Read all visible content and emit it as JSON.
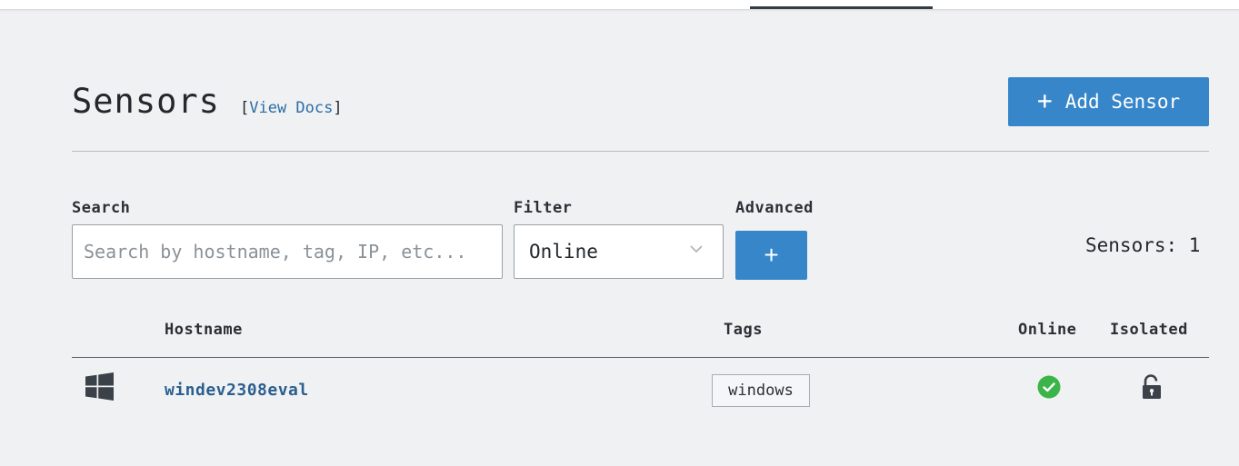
{
  "header": {
    "title": "Sensors",
    "docs_open": "[",
    "docs_link": "View Docs",
    "docs_close": "]",
    "add_button_label": "Add Sensor",
    "add_button_icon": "plus-icon"
  },
  "controls": {
    "search_label": "Search",
    "search_placeholder": "Search by hostname, tag, IP, etc...",
    "search_value": "",
    "filter_label": "Filter",
    "filter_value": "Online",
    "advanced_label": "Advanced",
    "advanced_button": "+",
    "sensor_count": "Sensors: 1"
  },
  "table": {
    "columns": [
      "",
      "Hostname",
      "Tags",
      "Online",
      "Isolated"
    ],
    "rows": [
      {
        "os_icon": "windows-icon",
        "hostname": "windev2308eval",
        "tags": [
          "windows"
        ],
        "online_icon": "check-circle-icon",
        "isolated_icon": "unlocked-padlock-icon"
      }
    ]
  },
  "colors": {
    "accent": "#3686c9",
    "link": "#2b5f8f",
    "online": "#3bb54a",
    "background": "#f0f1f3"
  }
}
